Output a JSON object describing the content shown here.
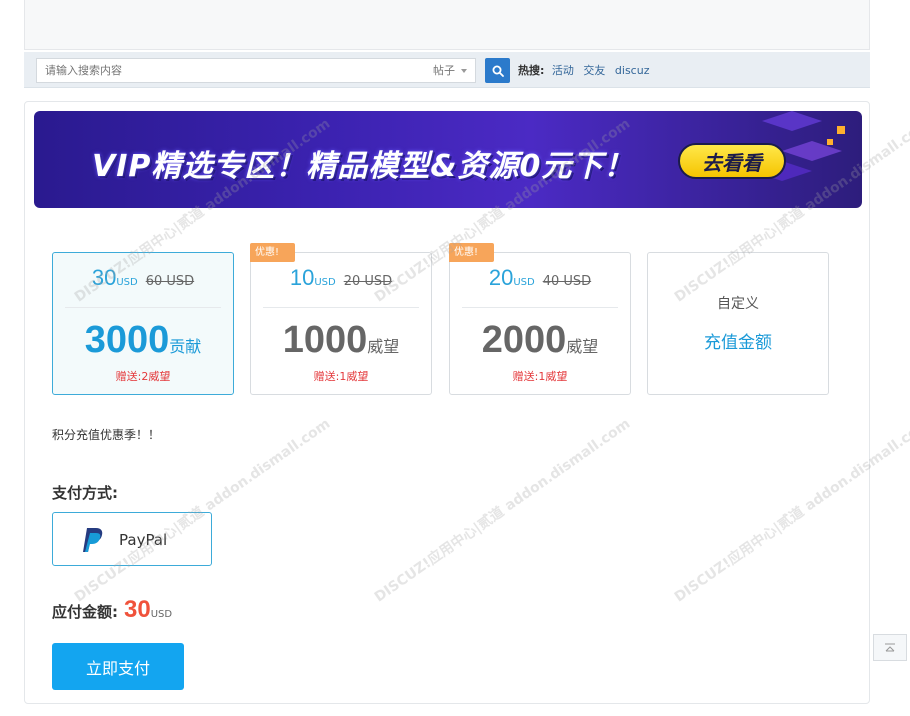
{
  "search": {
    "placeholder": "请输入搜索内容",
    "type_selected": "帖子",
    "hot_label": "热搜:",
    "hot_keywords": [
      "活动",
      "交友",
      "discuz"
    ]
  },
  "banner": {
    "text": "VIP精选专区！精品模型&资源0元下！",
    "button": "去看看"
  },
  "packages": [
    {
      "price": "30",
      "currency": "USD",
      "old_price": "60 USD",
      "amount": "3000",
      "amount_unit": "贡献",
      "gift": "赠送:2威望",
      "tag": "",
      "selected": true
    },
    {
      "price": "10",
      "currency": "USD",
      "old_price": "20 USD",
      "amount": "1000",
      "amount_unit": "威望",
      "gift": "赠送:1威望",
      "tag": "优惠!",
      "selected": false
    },
    {
      "price": "20",
      "currency": "USD",
      "old_price": "40 USD",
      "amount": "2000",
      "amount_unit": "威望",
      "gift": "赠送:1威望",
      "tag": "优惠!",
      "selected": false
    }
  ],
  "custom_package": {
    "line1": "自定义",
    "line2": "充值金额"
  },
  "promo_text": "积分充值优惠季！！",
  "payment": {
    "title": "支付方式:",
    "method": "PayPal",
    "amount_label": "应付金额:",
    "amount_value": "30",
    "amount_currency": "USD",
    "pay_button": "立即支付"
  },
  "watermark_text": "DISCUZ!应用中心|贰道 addon.dismall.com",
  "colors": {
    "accent": "#13a5f0",
    "price_red": "#f0523b",
    "tag_orange": "#f7a55a"
  }
}
